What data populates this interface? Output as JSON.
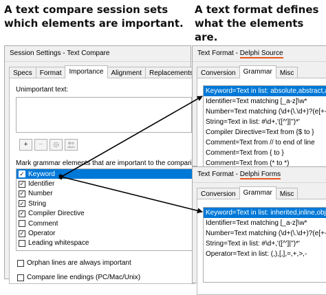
{
  "captions": {
    "left": "A text compare session sets which elements are important.",
    "right": "A text format defines what the elements are."
  },
  "session": {
    "title": "Session Settings - Text Compare",
    "tabs": [
      "Specs",
      "Format",
      "Importance",
      "Alignment",
      "Replacements"
    ],
    "active_tab": "Importance",
    "unimportant_label": "Unimportant text:",
    "unimportant_value": "",
    "toolbar": {
      "add": "+",
      "remove": "−",
      "gear": "gear",
      "users": "users"
    },
    "grammar_label": "Mark grammar elements that are important to the compari",
    "items": [
      {
        "label": "Keyword",
        "checked": true,
        "selected": true
      },
      {
        "label": "Identifier",
        "checked": true
      },
      {
        "label": "Number",
        "checked": true
      },
      {
        "label": "String",
        "checked": true
      },
      {
        "label": "Compiler Directive",
        "checked": true
      },
      {
        "label": "Comment",
        "checked": false
      },
      {
        "label": "Operator",
        "checked": true
      },
      {
        "label": "Leading whitespace",
        "checked": false
      }
    ],
    "orphan_label": "Orphan lines are always important",
    "compare_label": "Compare line endings (PC/Mac/Unix)"
  },
  "format1": {
    "title_prefix": "Text Format - ",
    "title_name": "Delphi Source",
    "tabs": [
      "Conversion",
      "Grammar",
      "Misc"
    ],
    "active_tab": "Grammar",
    "rows": [
      {
        "text": "Keyword=Text in list: absolute,abstract,and",
        "selected": true
      },
      {
        "text": "Identifier=Text matching [_a-z]\\w*"
      },
      {
        "text": "Number=Text matching (\\d+(\\.\\d+)?(e[+-]?"
      },
      {
        "text": "String=Text in list: #\\d+,'([^']|'')*'"
      },
      {
        "text": "Compiler Directive=Text from {$ to }"
      },
      {
        "text": "Comment=Text from // to end of line"
      },
      {
        "text": "Comment=Text from { to }"
      },
      {
        "text": "Comment=Text from (* to *)"
      }
    ]
  },
  "format2": {
    "title_prefix": "Text Format - ",
    "title_name": "Delphi Forms",
    "tabs": [
      "Conversion",
      "Grammar",
      "Misc"
    ],
    "active_tab": "Grammar",
    "rows": [
      {
        "text": "Keyword=Text in list: inherited,inline,obje",
        "selected": true
      },
      {
        "text": "Identifier=Text matching [_a-z]\\w*"
      },
      {
        "text": "Number=Text matching (\\d+(\\.\\d+)?(e[+-]"
      },
      {
        "text": "String=Text in list: #\\d+,'([^']|'')*'"
      },
      {
        "text": "Operator=Text in list: (,),[,],=,+,>,-"
      }
    ]
  },
  "colors": {
    "selection": "#0078d7",
    "accent_underline": "#e8531b",
    "arrow": "#000000"
  }
}
